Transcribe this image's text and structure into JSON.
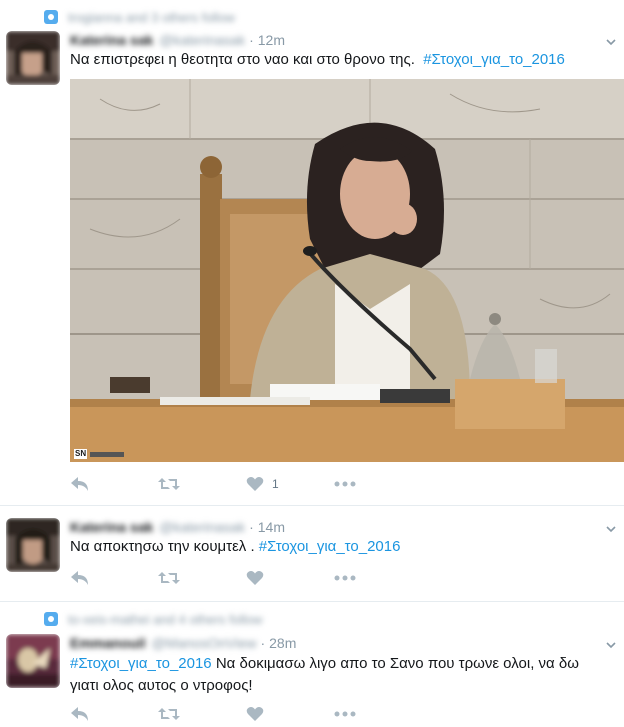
{
  "tweets": [
    {
      "context": "trogianna and 3 others follow",
      "name": "Katerina sak",
      "handle": "@katerinasak",
      "time": "12m",
      "text": "Να επιστρεφει η θεοτητα στο ναο και στο θρονο της.",
      "hashtag": "#Στοχοι_για_το_2016",
      "actions": {
        "like_count": "1"
      }
    },
    {
      "name": "Katerina sak",
      "handle": "@katerinasak",
      "time": "14m",
      "text": "Να αποκτησω την κουμτελ .",
      "hashtag": "#Στοχοι_για_το_2016"
    },
    {
      "context": "to-xeis-mathei and 4 others follow",
      "name": "Emmanouil",
      "handle": "@ManosOnView",
      "time": "28m",
      "hashtag": "#Στοχοι_για_το_2016",
      "text": "Να δοκιμασω λιγο απο το Σανο που τρωνε ολοι, να δω",
      "text_line2": "γιατι ολος αυτος ο ντροφος!"
    }
  ],
  "image_badge": "SN",
  "icons": [
    "reply-icon",
    "retweet-icon",
    "heart-icon",
    "more-icon",
    "chevron-down-icon",
    "follow-context-icon"
  ],
  "colors": {
    "hashtag": "#1b95e0",
    "muted": "#8899a6",
    "action": "#aab8c2",
    "context_icon": "#55acee"
  }
}
